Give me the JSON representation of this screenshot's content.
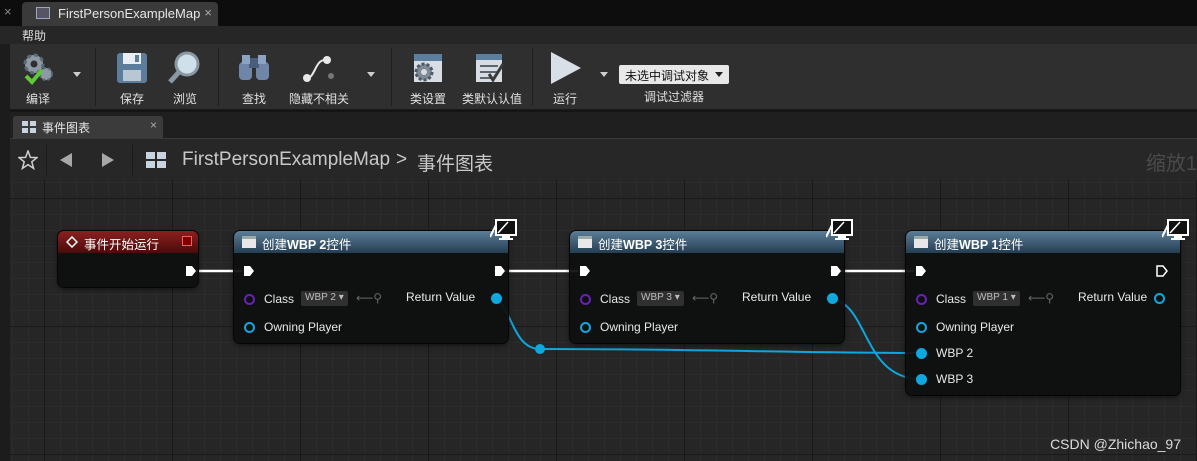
{
  "window": {
    "tab_title": "FirstPersonExampleMap",
    "tab_close": "×",
    "prev_tab_close": "×"
  },
  "menu": {
    "help": "帮助"
  },
  "toolbar": {
    "compile": "编译",
    "save": "保存",
    "browse": "浏览",
    "find": "查找",
    "hide_unrelated": "隐藏不相关",
    "class_settings": "类设置",
    "class_defaults": "类默认认值",
    "play": "运行",
    "debug_object": "未选中调试对象",
    "debug_filter": "调试过滤器"
  },
  "graph_tab": {
    "label": "事件图表",
    "close": "×"
  },
  "breadcrumb": {
    "map": "FirstPersonExampleMap",
    "separator": ">",
    "graph": "事件图表",
    "zoom": "缩放1"
  },
  "nodes": {
    "begin_play": {
      "title": "事件开始运行"
    },
    "create_wbp2": {
      "title_prefix": "创建",
      "title_bold": "WBP 2",
      "title_suffix": "控件",
      "class_label": "Class",
      "class_value": "WBP 2",
      "return_label": "Return Value",
      "owning_player": "Owning Player"
    },
    "create_wbp3": {
      "title_prefix": "创建",
      "title_bold": "WBP 3",
      "title_suffix": "控件",
      "class_label": "Class",
      "class_value": "WBP 3",
      "return_label": "Return Value",
      "owning_player": "Owning Player"
    },
    "create_wbp1": {
      "title_prefix": "创建",
      "title_bold": "WBP 1",
      "title_suffix": "控件",
      "class_label": "Class",
      "class_value": "WBP 1",
      "return_label": "Return Value",
      "owning_player": "Owning Player",
      "pin_wbp2": "WBP 2",
      "pin_wbp3": "WBP 3"
    }
  },
  "watermark": "CSDN @Zhichao_97",
  "colors": {
    "exec_wire": "#ffffff",
    "object_wire": "#0ea7de",
    "class_pin": "#5a1a9a",
    "node_header_blue": "#3f6480",
    "event_header_red": "#7a1515"
  }
}
